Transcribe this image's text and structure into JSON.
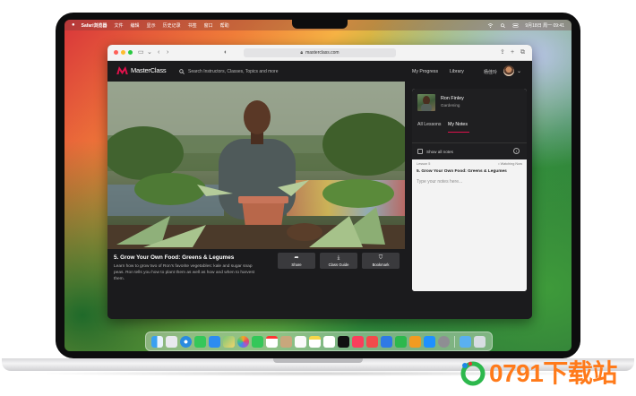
{
  "menubar": {
    "app": "Safari浏览器",
    "items": [
      "文件",
      "编辑",
      "显示",
      "历史记录",
      "书签",
      "窗口",
      "帮助"
    ],
    "datetime": "9月18日 周一 09:41"
  },
  "browser": {
    "url": "masterclass.com"
  },
  "site": {
    "logo_text": "MasterClass",
    "search_placeholder": "Search Instructors, Classes, Topics and more",
    "nav": {
      "progress": "My Progress",
      "library": "Library"
    },
    "user_name": "杨佳玲"
  },
  "lesson": {
    "title": "5. Grow Your Own Food: Greens & Legumes",
    "description": "Learn how to grow two of Ron's favorite vegetables: kale and sugar snap peas. Ron tells you how to plant them as well as how and when to harvest them.",
    "actions": {
      "share": "Share",
      "guide": "Class Guide",
      "bookmark": "Bookmark"
    }
  },
  "panel": {
    "instructor_name": "Ron Finley",
    "instructor_category": "Gardening",
    "tabs": [
      "All Lessons",
      "My Notes"
    ],
    "active_tab": "My Notes",
    "show_all_label": "Show all notes",
    "note": {
      "lesson_label": "Lesson 5",
      "status": "• Watching Now",
      "title": "5. Grow Your Own Food: Greens & Legumes",
      "placeholder": "Type your notes here..."
    }
  },
  "colors": {
    "brand_accent": "#e0114b",
    "page_bg": "#1b1b1d",
    "panel_bg": "#ffffff"
  },
  "watermark": {
    "text": "0791下载站"
  },
  "dock": {
    "icons": [
      "finder-icon",
      "launchpad-icon",
      "safari-icon",
      "messages-icon",
      "mail-icon",
      "maps-icon",
      "photos-icon",
      "facetime-icon",
      "calendar-icon",
      "contacts-icon",
      "reminders-icon",
      "notes-icon",
      "freeform-icon",
      "tv-icon",
      "music-icon",
      "news-icon",
      "keynote-icon",
      "numbers-icon",
      "pages-icon",
      "app-store-icon",
      "settings-icon",
      "downloads-folder-icon",
      "trash-icon"
    ]
  }
}
